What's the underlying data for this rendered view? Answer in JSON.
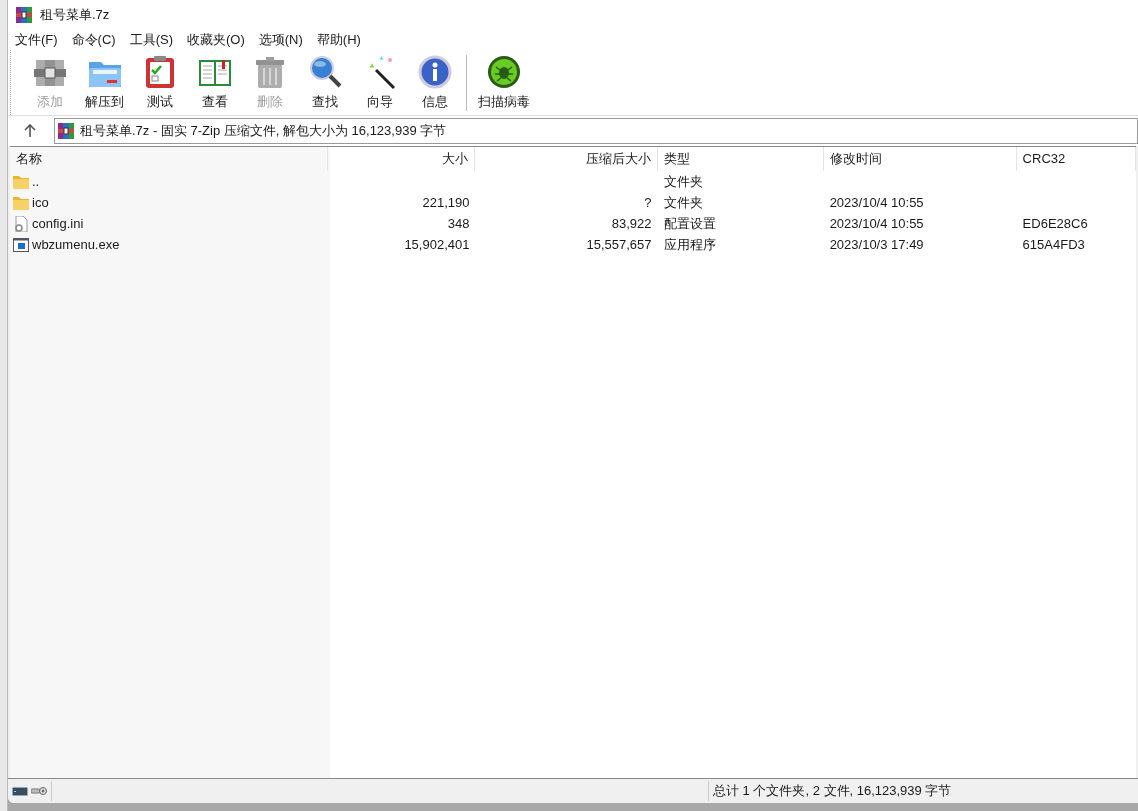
{
  "window": {
    "title": "租号菜单.7z"
  },
  "menu": [
    "文件(F)",
    "命令(C)",
    "工具(S)",
    "收藏夹(O)",
    "选项(N)",
    "帮助(H)"
  ],
  "toolbar": [
    {
      "kind": "add",
      "label": "添加",
      "disabled": true
    },
    {
      "kind": "extract",
      "label": "解压到",
      "disabled": false
    },
    {
      "kind": "test",
      "label": "测试",
      "disabled": false
    },
    {
      "kind": "view",
      "label": "查看",
      "disabled": false
    },
    {
      "kind": "delete",
      "label": "删除",
      "disabled": true
    },
    {
      "kind": "find",
      "label": "查找",
      "disabled": false
    },
    {
      "kind": "wizard",
      "label": "向导",
      "disabled": false
    },
    {
      "kind": "info",
      "label": "信息",
      "disabled": false
    },
    {
      "kind": "virus",
      "label": "扫描病毒",
      "disabled": false
    }
  ],
  "address": "租号菜单.7z - 固实 7-Zip 压缩文件, 解包大小为 16,123,939 字节",
  "table": {
    "columns": [
      "名称",
      "大小",
      "压缩后大小",
      "类型",
      "修改时间",
      "CRC32"
    ],
    "rows": [
      {
        "kind": "folder",
        "name": "..",
        "size": "",
        "packed": "",
        "type": "文件夹",
        "modified": "",
        "crc": ""
      },
      {
        "kind": "folder",
        "name": "ico",
        "size": "221,190",
        "packed": "?",
        "type": "文件夹",
        "modified": "2023/10/4 10:55",
        "crc": ""
      },
      {
        "kind": "config",
        "name": "config.ini",
        "size": "348",
        "packed": "83,922",
        "type": "配置设置",
        "modified": "2023/10/4 10:55",
        "crc": "ED6E28C6"
      },
      {
        "kind": "exe",
        "name": "wbzumenu.exe",
        "size": "15,902,401",
        "packed": "15,557,657",
        "type": "应用程序",
        "modified": "2023/10/3 17:49",
        "crc": "615A4FD3"
      }
    ]
  },
  "status_bar": "总计 1 个文件夹, 2 文件, 16,123,939 字节"
}
